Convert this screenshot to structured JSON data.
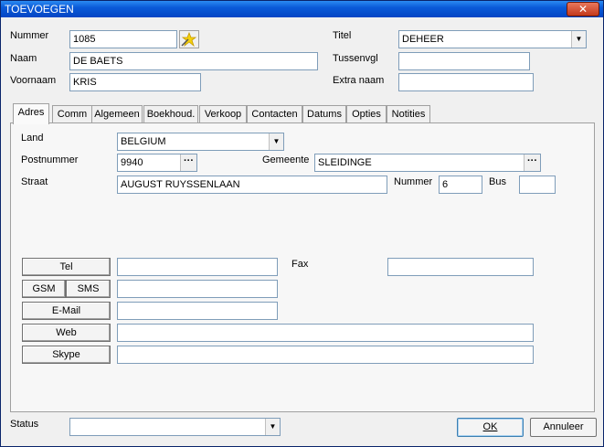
{
  "window": {
    "title": "TOEVOEGEN",
    "close_glyph": "✕"
  },
  "header": {
    "nummer_label": "Nummer",
    "nummer_value": "1085",
    "naam_label": "Naam",
    "naam_value": "DE BAETS",
    "voornaam_label": "Voornaam",
    "voornaam_value": "KRIS",
    "titel_label": "Titel",
    "titel_value": "DEHEER",
    "tussenvgl_label": "Tussenvgl",
    "tussenvgl_value": "",
    "extranaam_label": "Extra naam",
    "extranaam_value": ""
  },
  "tabs": [
    {
      "label": "Adres",
      "active": true
    },
    {
      "label": "Comm"
    },
    {
      "label": "Algemeen"
    },
    {
      "label": "Boekhoud."
    },
    {
      "label": "Verkoop"
    },
    {
      "label": "Contacten"
    },
    {
      "label": "Datums"
    },
    {
      "label": "Opties"
    },
    {
      "label": "Notities"
    }
  ],
  "adres": {
    "land_label": "Land",
    "land_value": "BELGIUM",
    "postnummer_label": "Postnummer",
    "postnummer_value": "9940",
    "gemeente_label": "Gemeente",
    "gemeente_value": "SLEIDINGE",
    "straat_label": "Straat",
    "straat_value": "AUGUST RUYSSENLAAN",
    "nummer_label": "Nummer",
    "nummer_value": "6",
    "bus_label": "Bus",
    "bus_value": ""
  },
  "comm": {
    "tel_label": "Tel",
    "tel_value": "",
    "fax_label": "Fax",
    "fax_value": "",
    "gsm_label": "GSM",
    "sms_label": "SMS",
    "gsm_value": "",
    "email_label": "E-Mail",
    "email_value": "",
    "web_label": "Web",
    "web_value": "",
    "skype_label": "Skype",
    "skype_value": ""
  },
  "footer": {
    "status_label": "Status",
    "status_value": "",
    "ok_label": "OK",
    "cancel_label": "Annuleer"
  },
  "glyphs": {
    "dropdown": "▼",
    "dots": "···"
  }
}
